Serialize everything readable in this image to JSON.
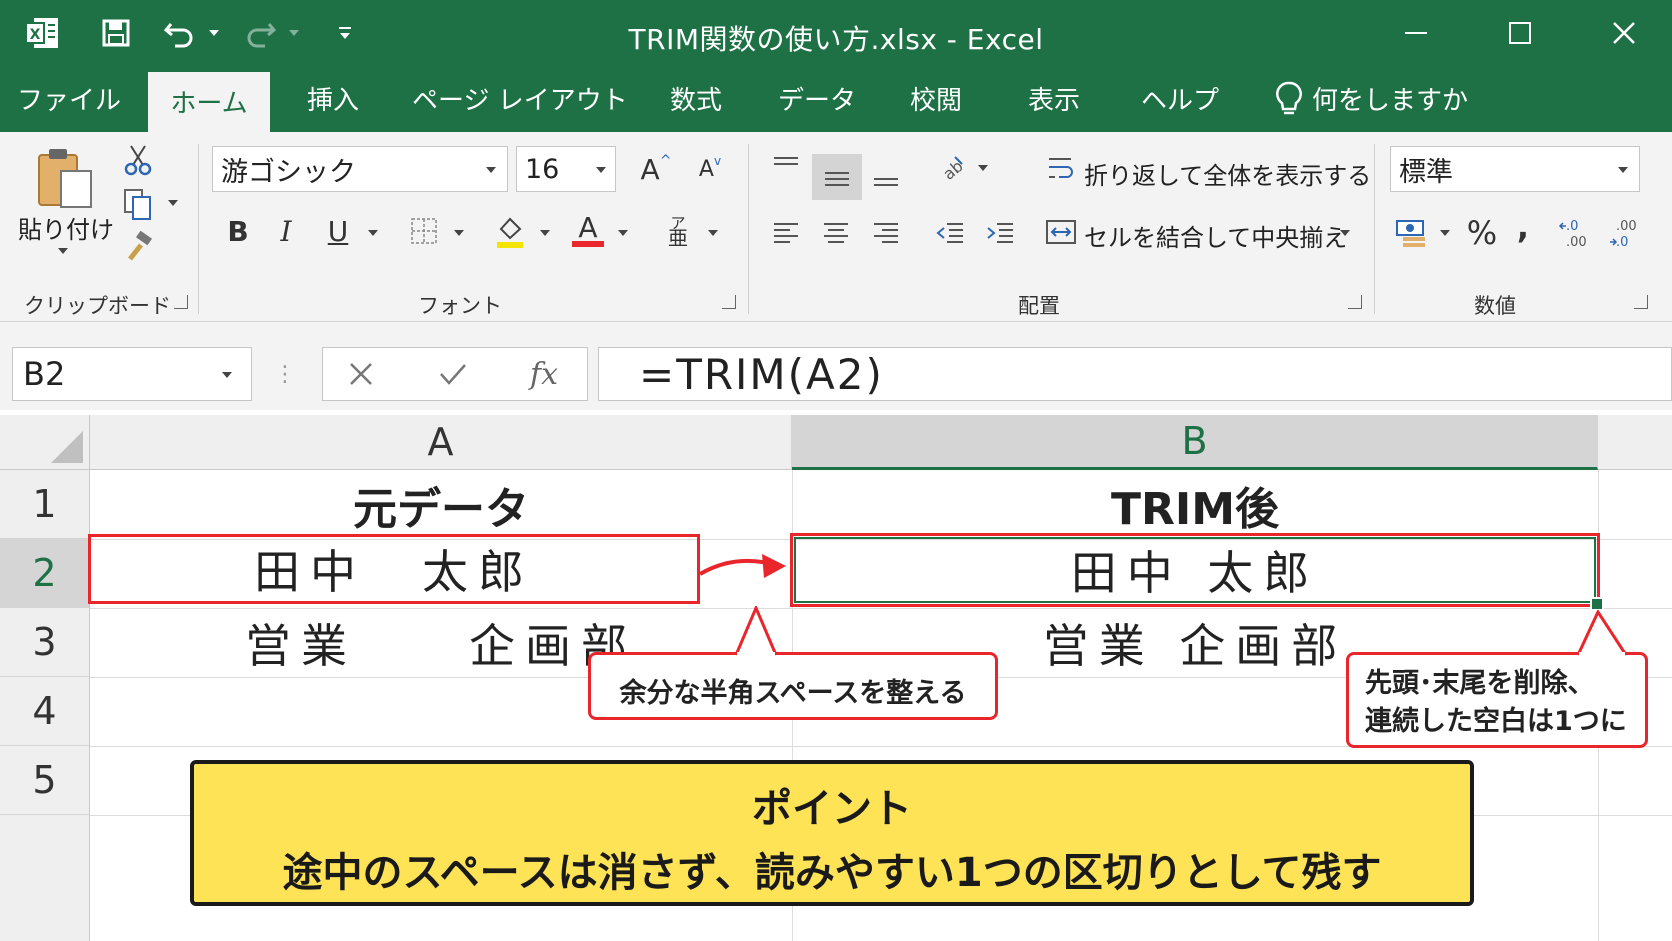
{
  "title": "TRIM関数の使い方.xlsx  -  Excel",
  "tabs": [
    "ファイル",
    "ホーム",
    "挿入",
    "ページ レイアウト",
    "数式",
    "データ",
    "校閲",
    "表示",
    "ヘルプ",
    "何をしますか"
  ],
  "ribbon": {
    "clipboard": {
      "paste": "貼り付け",
      "label": "クリップボード"
    },
    "font": {
      "name": "游ゴシック",
      "size": "16",
      "label": "フォント"
    },
    "alignment": {
      "wrap": "折り返して全体を表示する",
      "merge": "セルを結合して中央揃え",
      "label": "配置"
    },
    "number": {
      "format": "標準",
      "percent": "%",
      "comma": ",",
      "label": "数値"
    }
  },
  "formula_bar": {
    "name_box": "B2",
    "fx": "fx",
    "formula": "=TRIM(A2)"
  },
  "columns": [
    "A",
    "B"
  ],
  "rows": [
    "1",
    "2",
    "3",
    "4",
    "5"
  ],
  "cells": {
    "A1": "元データ",
    "B1": "TRIM後",
    "A2": "田中　太郎",
    "B2": "田中 太郎",
    "A3": "営業　　企画部",
    "B3": "営業 企画部"
  },
  "callouts": {
    "left": "余分な半角スペースを整える",
    "right_line1": "先頭･末尾を削除、",
    "right_line2": "連続した空白は1つに"
  },
  "point": {
    "heading": "ポイント",
    "text": "途中のスペースは消さず、読みやすい1つの区切りとして残す"
  },
  "colors": {
    "excel_green": "#1e7145",
    "red": "#e8262b",
    "yellow": "#fde355"
  }
}
